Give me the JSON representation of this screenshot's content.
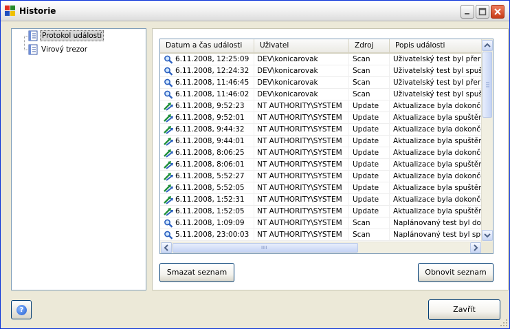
{
  "window": {
    "title": "Historie",
    "accent": "#0831d9"
  },
  "tree": {
    "items": [
      {
        "label": "Protokol událostí",
        "selected": true,
        "icon": "log-document-icon"
      },
      {
        "label": "Virový trezor",
        "selected": false,
        "icon": "vault-document-icon"
      }
    ]
  },
  "table": {
    "columns": [
      "Datum a čas události",
      "Uživatel",
      "Zdroj",
      "Popis události"
    ],
    "rows": [
      {
        "icon": "magnifier-icon",
        "datetime": "6.11.2008, 12:25:09",
        "user": "DEV\\konicarovak",
        "source": "Scan",
        "description": "Uživatelský test byl přeruše"
      },
      {
        "icon": "magnifier-icon",
        "datetime": "6.11.2008, 12:24:32",
        "user": "DEV\\konicarovak",
        "source": "Scan",
        "description": "Uživatelský test byl spuštěn"
      },
      {
        "icon": "magnifier-icon",
        "datetime": "6.11.2008, 11:46:45",
        "user": "DEV\\konicarovak",
        "source": "Scan",
        "description": "Uživatelský test byl přeruše"
      },
      {
        "icon": "magnifier-icon",
        "datetime": "6.11.2008, 11:46:02",
        "user": "DEV\\konicarovak",
        "source": "Scan",
        "description": "Uživatelský test byl spuštěn"
      },
      {
        "icon": "update-arrows-icon",
        "datetime": "6.11.2008, 9:52:23",
        "user": "NT AUTHORITY\\SYSTEM",
        "source": "Update",
        "description": "Aktualizace byla dokončena"
      },
      {
        "icon": "update-arrows-icon",
        "datetime": "6.11.2008, 9:52:01",
        "user": "NT AUTHORITY\\SYSTEM",
        "source": "Update",
        "description": "Aktualizace byla spuštěna"
      },
      {
        "icon": "update-arrows-icon",
        "datetime": "6.11.2008, 9:44:32",
        "user": "NT AUTHORITY\\SYSTEM",
        "source": "Update",
        "description": "Aktualizace byla dokončena"
      },
      {
        "icon": "update-arrows-icon",
        "datetime": "6.11.2008, 9:44:01",
        "user": "NT AUTHORITY\\SYSTEM",
        "source": "Update",
        "description": "Aktualizace byla spuštěna"
      },
      {
        "icon": "update-arrows-icon",
        "datetime": "6.11.2008, 8:06:25",
        "user": "NT AUTHORITY\\SYSTEM",
        "source": "Update",
        "description": "Aktualizace byla dokončena"
      },
      {
        "icon": "update-arrows-icon",
        "datetime": "6.11.2008, 8:06:01",
        "user": "NT AUTHORITY\\SYSTEM",
        "source": "Update",
        "description": "Aktualizace byla spuštěna"
      },
      {
        "icon": "update-arrows-icon",
        "datetime": "6.11.2008, 5:52:27",
        "user": "NT AUTHORITY\\SYSTEM",
        "source": "Update",
        "description": "Aktualizace byla dokončena"
      },
      {
        "icon": "update-arrows-icon",
        "datetime": "6.11.2008, 5:52:05",
        "user": "NT AUTHORITY\\SYSTEM",
        "source": "Update",
        "description": "Aktualizace byla spuštěna"
      },
      {
        "icon": "update-arrows-icon",
        "datetime": "6.11.2008, 1:52:31",
        "user": "NT AUTHORITY\\SYSTEM",
        "source": "Update",
        "description": "Aktualizace byla dokončena"
      },
      {
        "icon": "update-arrows-icon",
        "datetime": "6.11.2008, 1:52:05",
        "user": "NT AUTHORITY\\SYSTEM",
        "source": "Update",
        "description": "Aktualizace byla spuštěna"
      },
      {
        "icon": "magnifier-icon",
        "datetime": "6.11.2008, 1:09:09",
        "user": "NT AUTHORITY\\SYSTEM",
        "source": "Scan",
        "description": "Naplánovaný test byl dokon"
      },
      {
        "icon": "magnifier-icon",
        "datetime": "5.11.2008, 23:00:03",
        "user": "NT AUTHORITY\\SYSTEM",
        "source": "Scan",
        "description": "Naplánovaný test byl spušt"
      }
    ]
  },
  "buttons": {
    "clear_list": "Smazat seznam",
    "refresh_list": "Obnovit seznam",
    "close": "Zavřít"
  },
  "scrollbar": {
    "h_thumb_grip": "IIII"
  }
}
